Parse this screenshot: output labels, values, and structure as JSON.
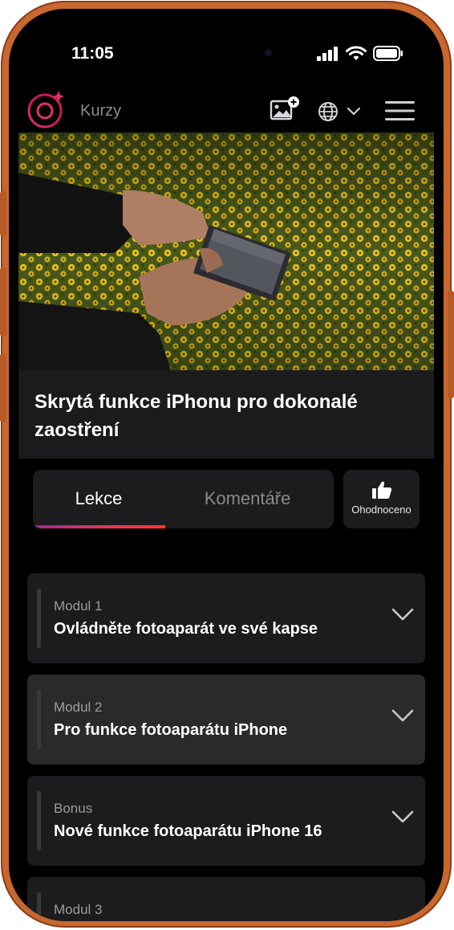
{
  "status_bar": {
    "time": "11:05",
    "icons": [
      "signal-bars-icon",
      "wifi-icon",
      "battery-icon"
    ]
  },
  "nav": {
    "title": "Kurzy",
    "icons": [
      "logo-icon",
      "gallery-add-icon",
      "globe-icon",
      "chevron-down-icon",
      "hamburger-menu-icon"
    ]
  },
  "course": {
    "title": "Skrytá funkce iPhonu pro dokonalé zaostření"
  },
  "tabs": {
    "lessons": "Lekce",
    "comments": "Komentáře",
    "active": "Lekce"
  },
  "rating": {
    "label": "Ohodnoceno",
    "icon": "thumbs-up-icon"
  },
  "modules": [
    {
      "label": "Modul 1",
      "title": "Ovládněte fotoaparát ve své kapse"
    },
    {
      "label": "Modul 2",
      "title": "Pro funkce fotoaparátu iPhone"
    },
    {
      "label": "Bonus",
      "title": "Nové funkce fotoaparátu iPhone 16"
    },
    {
      "label": "Modul 3",
      "title": ""
    }
  ],
  "colors": {
    "frame": "#c8672e",
    "background": "#000000",
    "card": "#1c1c1e",
    "card_highlight": "#2a2a2d",
    "accent_gradient_start": "#9c2a8a",
    "accent_gradient_end": "#ff3a2f"
  }
}
